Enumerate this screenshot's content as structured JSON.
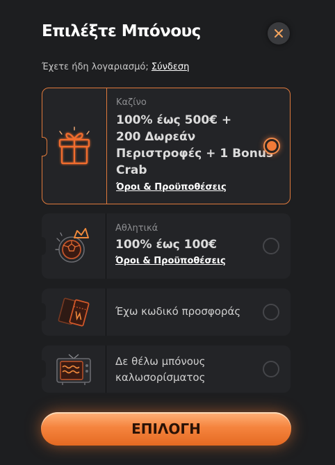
{
  "header": {
    "title": "Επιλέξτε Μπόνους",
    "close_icon": "close-icon"
  },
  "login": {
    "prompt": "Έχετε ήδη λογαριασμό;",
    "link": "Σύνδεση"
  },
  "options": [
    {
      "category": "Καζίνο",
      "offer_lines": [
        "100% έως 500€ +",
        "200 Δωρεάν",
        "Περιστροφές + 1 Bonus",
        "Crab"
      ],
      "terms": "Όροι & Προϋποθέσεις",
      "icon": "gift-icon",
      "selected": true
    },
    {
      "category": "Αθλητικά",
      "offer_lines": [
        "100% έως 100€"
      ],
      "terms": "Όροι & Προϋποθέσεις",
      "icon": "football-crown-icon",
      "selected": false
    },
    {
      "label": "Έχω κωδικό προσφοράς",
      "icon": "ticket-icon",
      "selected": false
    },
    {
      "label_lines": [
        "Δε θέλω μπόνους",
        "καλωσορίσματος"
      ],
      "icon": "tv-icon",
      "selected": false
    }
  ],
  "colors": {
    "accent": "#f07a38",
    "background": "#1d1e20",
    "card": "#232427"
  },
  "cta": {
    "label": "ΕΠΙΛΟΓΗ"
  }
}
